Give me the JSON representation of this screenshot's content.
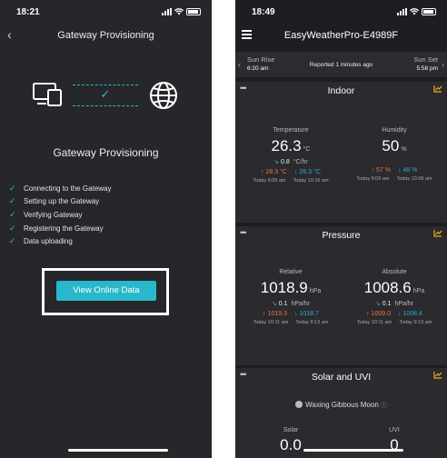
{
  "left": {
    "status_time": "18:21",
    "nav_title": "Gateway Provisioning",
    "heading": "Gateway Provisioning",
    "steps": [
      "Connecting to the Gateway",
      "Setting up the Gateway",
      "Verifying Gateway",
      "Registering the Gateway",
      "Data uploading"
    ],
    "view_button": "View Online Data"
  },
  "right": {
    "status_time": "18:49",
    "station_name": "EasyWeatherPro-E4989F",
    "sun": {
      "rise_label": "Sun Rise",
      "rise_time": "6:20 am",
      "reported": "Reported 1 minutes ago",
      "set_label": "Sun Set",
      "set_time": "5:58 pm"
    },
    "indoor": {
      "title": "Indoor",
      "temp_label": "Temperature",
      "temp_value": "26.3",
      "temp_unit": "°C",
      "temp_rate": "0.8",
      "temp_rate_unit": "°C/hr",
      "temp_high": "28.3 °C",
      "temp_low": "26.3 °C",
      "temp_high_time": "Today 9:09 am",
      "temp_low_time": "Today 10:16 am",
      "hum_label": "Humidity",
      "hum_value": "50",
      "hum_unit": "%",
      "hum_high": "57 %",
      "hum_low": "48 %",
      "hum_high_time": "Today 9:09 am",
      "hum_low_time": "Today 10:08 am"
    },
    "pressure": {
      "title": "Pressure",
      "rel_label": "Relative",
      "rel_value": "1018.9",
      "rel_unit": "hPa",
      "rel_rate": "0.1",
      "rel_rate_unit": "hPa/hr",
      "rel_high": "1019.3",
      "rel_low": "1018.7",
      "rel_high_time": "Today 10:11 am",
      "rel_low_time": "Today 9:13 am",
      "abs_label": "Absolute",
      "abs_value": "1008.6",
      "abs_unit": "hPa",
      "abs_rate": "0.1",
      "abs_rate_unit": "hPa/hr",
      "abs_high": "1009.0",
      "abs_low": "1008.4",
      "abs_high_time": "Today 10:11 am",
      "abs_low_time": "Today 9:13 am"
    },
    "solar": {
      "title": "Solar and UVI",
      "moon": "Waxing Gibbous Moon",
      "solar_label": "Solar",
      "solar_value": "0.0",
      "uvi_label": "UVI",
      "uvi_value": "0"
    }
  },
  "colors": {
    "accent": "#29b8cb",
    "high": "#e47a3f",
    "low": "#2fa8d8",
    "chart_icon": "#e8b21e"
  }
}
